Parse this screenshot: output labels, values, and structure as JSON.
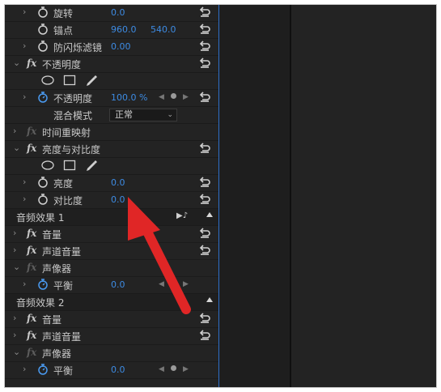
{
  "rows": {
    "rotation": {
      "label": "旋转",
      "value": "0.0"
    },
    "anchor": {
      "label": "锚点",
      "x": "960.0",
      "y": "540.0"
    },
    "antiflicker": {
      "label": "防闪烁滤镜",
      "value": "0.00"
    },
    "opacity_fx": {
      "label": "不透明度"
    },
    "opacity_param": {
      "label": "不透明度",
      "value": "100.0 %"
    },
    "blend_mode": {
      "label": "混合模式",
      "value": "正常"
    },
    "time_remap": {
      "label": "时间重映射"
    },
    "brightness_contrast": {
      "label": "亮度与对比度"
    },
    "brightness": {
      "label": "亮度",
      "value": "0.0"
    },
    "contrast": {
      "label": "对比度",
      "value": "0.0"
    },
    "audio1": {
      "label": "音频效果 1"
    },
    "volume1": {
      "label": "音量"
    },
    "channel_volume1": {
      "label": "声道音量"
    },
    "panner1": {
      "label": "声像器"
    },
    "balance1": {
      "label": "平衡",
      "value": "0.0"
    },
    "audio2": {
      "label": "音频效果 2"
    },
    "volume2": {
      "label": "音量"
    },
    "channel_volume2": {
      "label": "声道音量"
    },
    "panner2": {
      "label": "声像器"
    },
    "balance2": {
      "label": "平衡",
      "value": "0.0"
    }
  },
  "fx_glyph": "fx",
  "colors": {
    "value_blue": "#3d8be3",
    "arrow_red": "#e02626",
    "panel": "#232323",
    "playhead": "#2f6fc9"
  },
  "icons": [
    "chevron-right-icon",
    "chevron-down-icon",
    "stopwatch-icon",
    "reset-icon",
    "ellipse-mask-icon",
    "rectangle-mask-icon",
    "pen-mask-icon",
    "audio-clip-icon",
    "collapse-up-icon",
    "keyframe-nav-icon"
  ]
}
